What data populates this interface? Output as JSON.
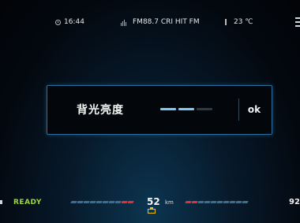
{
  "status": {
    "time": "16:44",
    "radio": "FM88.7 CRI HIT FM",
    "temperature": "23 ℃"
  },
  "dialog": {
    "title": "背光亮度",
    "ok_label": "ok",
    "brightness_level_filled_segments": 2,
    "brightness_level_total_segments": 3
  },
  "footer": {
    "ready_label": "READY",
    "range_value": "52",
    "range_unit": "km",
    "right_value": "92"
  },
  "colors": {
    "accent_blue": "#7fc8f0",
    "ready_green": "#9bd63a",
    "warning_red": "#e0303a",
    "battery_yellow": "#f0c419"
  }
}
